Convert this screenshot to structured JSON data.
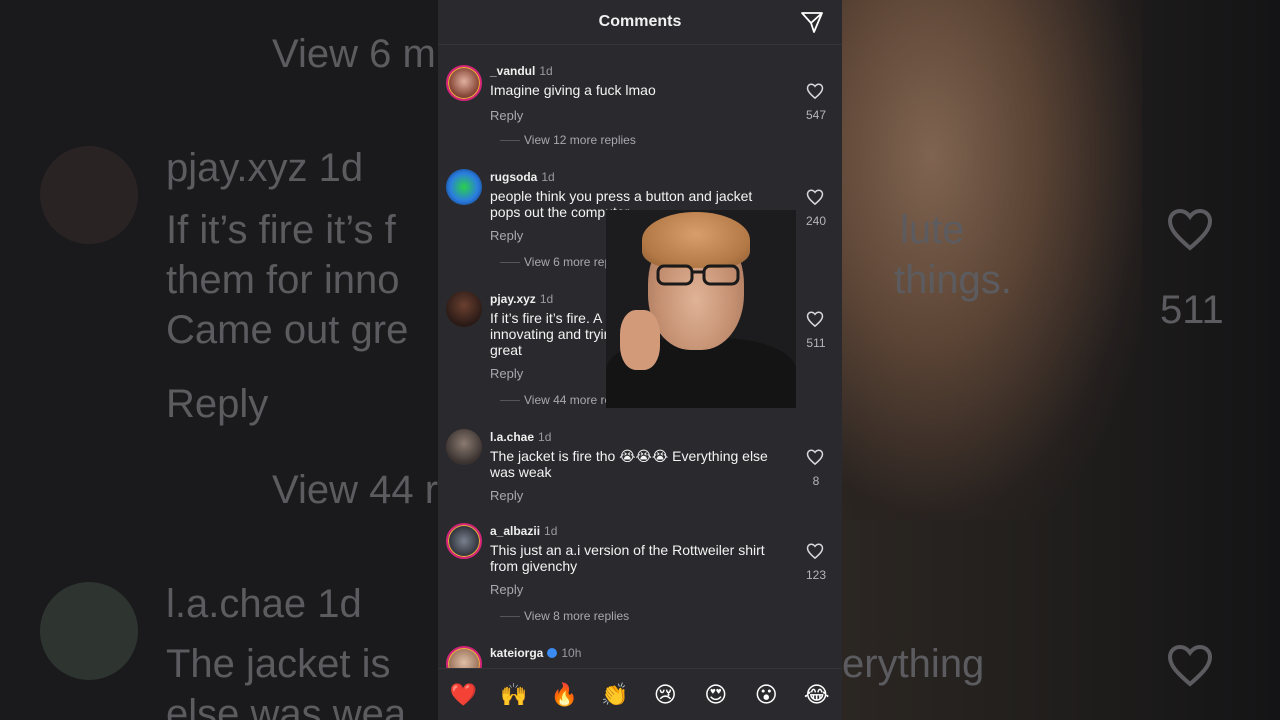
{
  "header": {
    "title": "Comments",
    "share_icon": "send-icon"
  },
  "comments": [
    {
      "username": "_vandul",
      "time": "1d",
      "text": "Imagine giving a fuck lmao",
      "reply": "Reply",
      "likes": "547",
      "more": "View 12 more replies",
      "avatar_color": "#7a3a2e"
    },
    {
      "username": "rugsoda",
      "time": "1d",
      "text": "people think you press a button and jacket pops out the computer",
      "reply": "Reply",
      "likes": "240",
      "more": "View 6 more replies",
      "avatar_color": "#2b7de0"
    },
    {
      "username": "pjay.xyz",
      "time": "1d",
      "text": "If it’s fire it’s fire. A lot is just absolute them for innovating and trying new things. Came out great",
      "reply": "Reply",
      "likes": "511",
      "more": "View 44 more replies",
      "avatar_color": "#3a2a25"
    },
    {
      "username": "l.a.chae",
      "time": "1d",
      "text": "The jacket is fire tho 😭😭😭 Everything else was weak",
      "reply": "Reply",
      "likes": "8",
      "avatar_color": "#4e4540"
    },
    {
      "username": "a_albazii",
      "time": "1d",
      "text": "This just an a.i version of the Rottweiler shirt from givenchy",
      "reply": "Reply",
      "likes": "123",
      "more": "View 8 more replies",
      "avatar_color": "#3d4350"
    },
    {
      "username": "kateiorga",
      "time": "10h",
      "verified": true,
      "avatar_color": "#a07860"
    }
  ],
  "emojis": [
    "❤️",
    "🙌",
    "🔥",
    "👏",
    "😢",
    "😍",
    "😮",
    "😂"
  ],
  "background": {
    "left_texts": [
      "View 6 m",
      "pjay.xyz 1d",
      "If it’s fire it’s f",
      "them for inno",
      "Came out gre",
      "Reply",
      "View 44 r",
      "l.a.chae 1d",
      "The jacket is",
      "else was wea"
    ],
    "right_texts": [
      "lute",
      "things.",
      "511",
      "erything"
    ]
  }
}
